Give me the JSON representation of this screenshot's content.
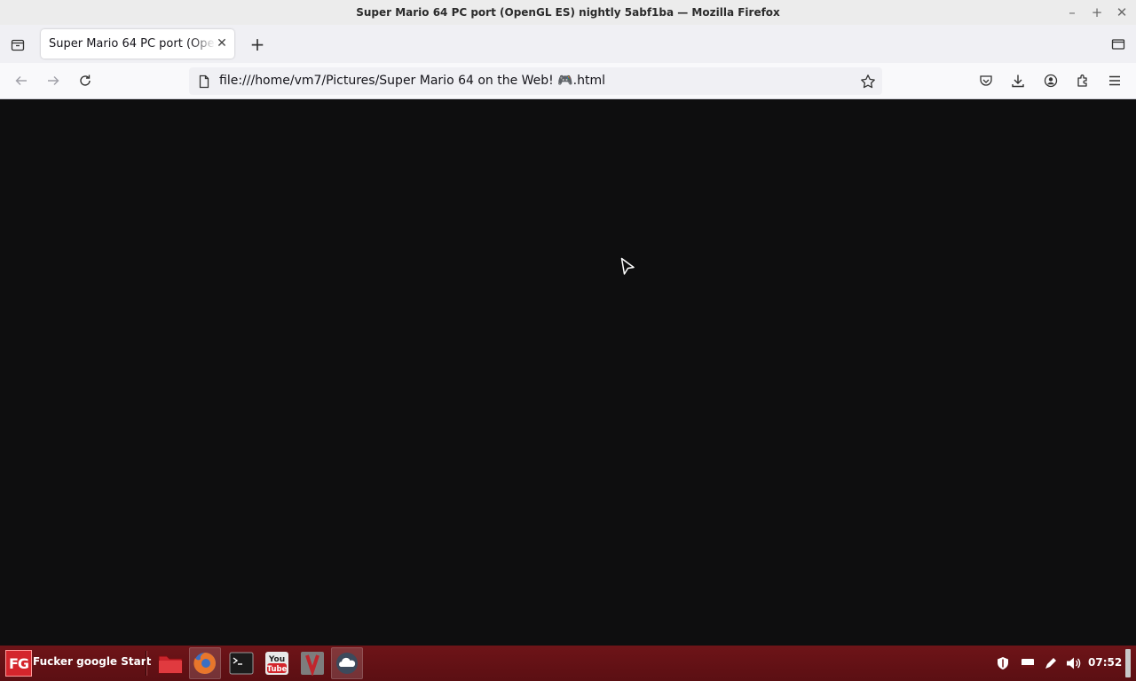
{
  "window": {
    "title": "Super Mario 64 PC port (OpenGL ES) nightly 5abf1ba — Mozilla Firefox",
    "controls": [
      "minimize-icon",
      "maximize-icon",
      "close-icon"
    ]
  },
  "tabs": [
    {
      "title": "Super Mario 64 PC port (OpenGL ES) nightly 5abf1ba",
      "active": true
    }
  ],
  "navbar": {
    "url": "file:///home/vm7/Pictures/Super Mario 64 on the Web! 🎮.html",
    "icons": [
      "back-icon",
      "forward-icon",
      "reload-icon",
      "page-icon",
      "bookmark-star-icon",
      "pocket-icon",
      "downloads-icon",
      "account-icon",
      "extensions-icon",
      "menu-icon"
    ]
  },
  "taskbar": {
    "start_logo": "FG",
    "start_label": "Fucker google Start",
    "apps": [
      "files-icon",
      "firefox-icon",
      "terminal-icon",
      "youtube-icon",
      "vivaldi-icon",
      "cloud-icon"
    ],
    "youtube_text_top": "You",
    "youtube_text_bottom": "Tube",
    "tray": [
      "shield-icon",
      "display-icon",
      "pen-icon",
      "volume-icon"
    ],
    "clock": "07:52"
  },
  "colors": {
    "content_bg": "#0e0e0f",
    "taskbar_bg": "#5b0f13",
    "start_logo_bg": "#d4252c"
  }
}
